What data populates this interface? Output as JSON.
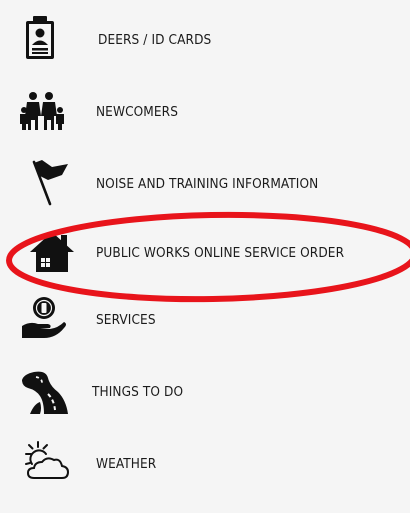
{
  "menu": {
    "items": [
      {
        "label": "DEERS / ID CARDS",
        "icon": "id-card-icon"
      },
      {
        "label": "NEWCOMERS",
        "icon": "family-icon"
      },
      {
        "label": "NOISE AND TRAINING INFORMATION",
        "icon": "flag-icon"
      },
      {
        "label": "PUBLIC WORKS ONLINE SERVICE ORDER",
        "icon": "house-icon"
      },
      {
        "label": "SERVICES",
        "icon": "hand-coin-icon"
      },
      {
        "label": "THINGS TO DO",
        "icon": "road-icon"
      },
      {
        "label": "WEATHER",
        "icon": "sun-cloud-icon"
      }
    ]
  },
  "highlight": {
    "color": "#e8141b",
    "target": "PUBLIC WORKS ONLINE SERVICE ORDER"
  }
}
